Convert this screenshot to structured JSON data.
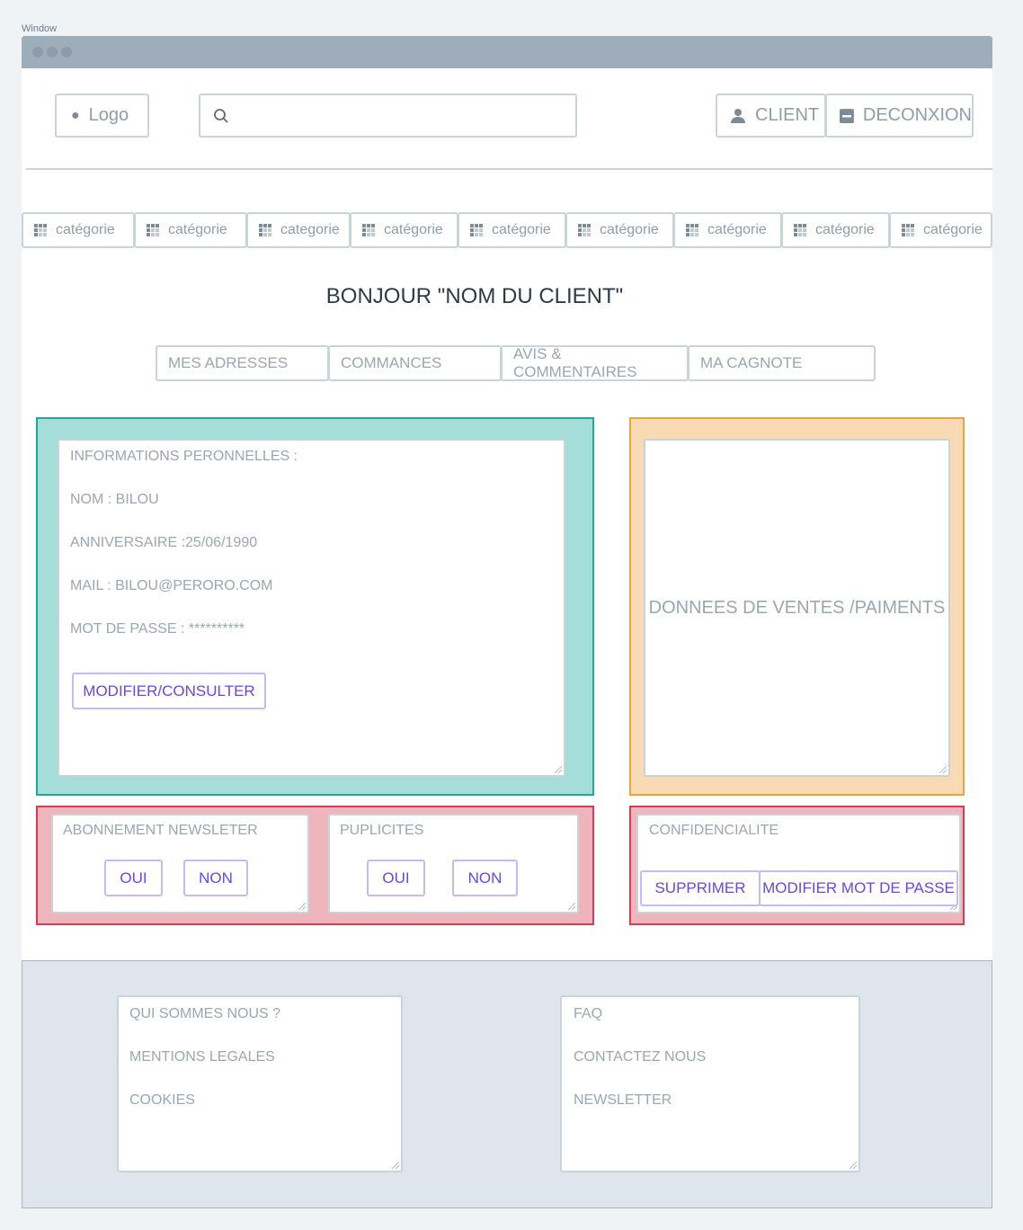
{
  "window": {
    "label": "Window"
  },
  "header": {
    "logo_label": "Logo",
    "search_placeholder": "",
    "client_label": "CLIENT",
    "logout_label": "DECONXION"
  },
  "categories": [
    "catégorie",
    "catégorie",
    "categorie",
    "catégorie",
    "catégorie",
    "catégorie",
    "catégorie",
    "catégorie",
    "catégorie"
  ],
  "greeting": "BONJOUR \"NOM DU CLIENT\"",
  "tabs": [
    "MES ADRESSES",
    "COMMANCES",
    "AVIS & COMMENTAIRES",
    "MA CAGNOTE"
  ],
  "personal": {
    "heading": "INFORMATIONS PERONNELLES :",
    "name": "NOM : BILOU",
    "birthday": "ANNIVERSAIRE :25/06/1990",
    "mail": "MAIL : BILOU@PERORO.COM",
    "password": "MOT DE PASSE : **********",
    "edit_label": "MODIFIER/CONSULTER"
  },
  "sales": {
    "label": "DONNEES DE VENTES /PAIMENTS"
  },
  "newsletter": {
    "label": "ABONNEMENT NEWSLETER",
    "yes": "OUI",
    "no": "NON"
  },
  "ads": {
    "label": "PUPLICITES",
    "yes": "OUI",
    "no": "NON"
  },
  "privacy": {
    "label": "CONFIDENCIALITE",
    "delete_label": "SUPPRIMER",
    "change_password_label": "MODIFIER MOT DE PASSE"
  },
  "footer": {
    "left": [
      "QUI SOMMES NOUS ?",
      "MENTIONS LEGALES",
      "COOKIES"
    ],
    "right": [
      "FAQ",
      "CONTACTEZ NOUS",
      "NEWSLETTER"
    ]
  },
  "colors": {
    "teal_panel": "#a5ded8",
    "orange_panel": "#f8dbb4",
    "red_panel": "#eeb5bd",
    "accent": "#6248f0"
  }
}
